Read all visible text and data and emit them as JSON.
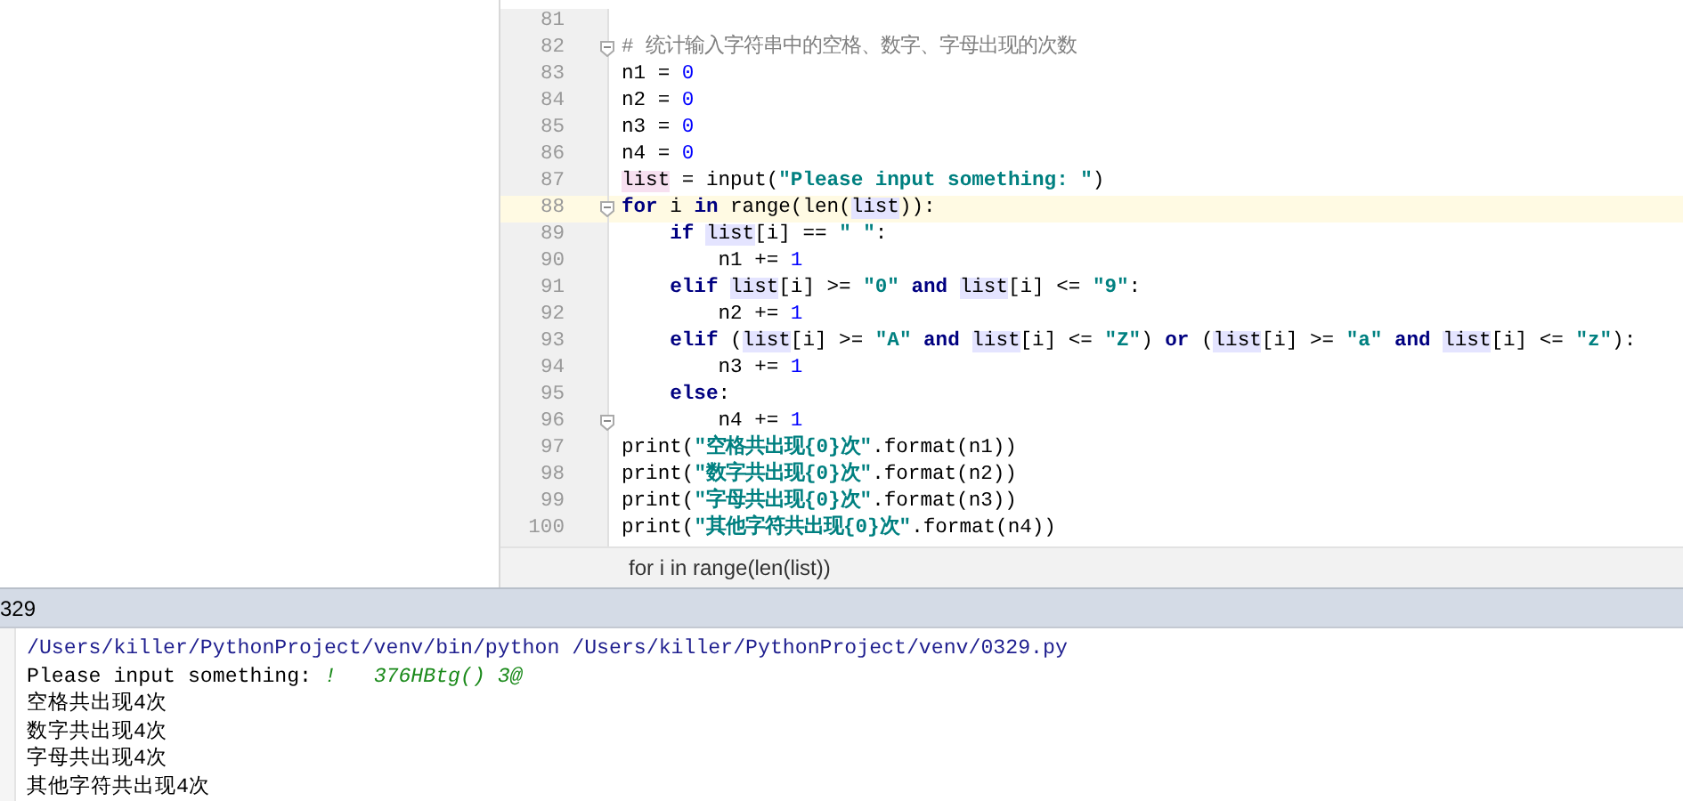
{
  "editor": {
    "lines": [
      {
        "number": "81",
        "current": false,
        "fold": false
      },
      {
        "number": "82",
        "current": false,
        "fold": true,
        "tokens": [
          {
            "kind": "comment",
            "t": "# 统计输入字符串中的空格、数字、字母出现的次数"
          }
        ]
      },
      {
        "number": "83",
        "current": false,
        "fold": false,
        "tokens": [
          {
            "kind": "plain",
            "t": "n1 = "
          },
          {
            "kind": "num",
            "t": "0"
          }
        ]
      },
      {
        "number": "84",
        "current": false,
        "fold": false,
        "tokens": [
          {
            "kind": "plain",
            "t": "n2 = "
          },
          {
            "kind": "num",
            "t": "0"
          }
        ]
      },
      {
        "number": "85",
        "current": false,
        "fold": false,
        "tokens": [
          {
            "kind": "plain",
            "t": "n3 = "
          },
          {
            "kind": "num",
            "t": "0"
          }
        ]
      },
      {
        "number": "86",
        "current": false,
        "fold": false,
        "tokens": [
          {
            "kind": "plain",
            "t": "n4 = "
          },
          {
            "kind": "num",
            "t": "0"
          }
        ]
      },
      {
        "number": "87",
        "current": false,
        "fold": false,
        "tokens": [
          {
            "kind": "vardef",
            "t": "list"
          },
          {
            "kind": "plain",
            "t": " = input("
          },
          {
            "kind": "str",
            "t": "\"Please input something: \""
          },
          {
            "kind": "plain",
            "t": ")"
          }
        ]
      },
      {
        "number": "88",
        "current": true,
        "fold": true,
        "tokens": [
          {
            "kind": "kw",
            "t": "for"
          },
          {
            "kind": "plain",
            "t": " i "
          },
          {
            "kind": "kw",
            "t": "in"
          },
          {
            "kind": "plain",
            "t": " range(len("
          },
          {
            "kind": "var",
            "t": "list"
          },
          {
            "kind": "plain",
            "t": ")):"
          }
        ]
      },
      {
        "number": "89",
        "current": false,
        "fold": false,
        "tokens": [
          {
            "kind": "kw",
            "t": "    if "
          },
          {
            "kind": "var",
            "t": "list"
          },
          {
            "kind": "plain",
            "t": "[i] == "
          },
          {
            "kind": "str",
            "t": "\" \""
          },
          {
            "kind": "plain",
            "t": ":"
          }
        ]
      },
      {
        "number": "90",
        "current": false,
        "fold": false,
        "tokens": [
          {
            "kind": "plain",
            "t": "        n1 += "
          },
          {
            "kind": "num",
            "t": "1"
          }
        ]
      },
      {
        "number": "91",
        "current": false,
        "fold": false,
        "tokens": [
          {
            "kind": "kw",
            "t": "    elif "
          },
          {
            "kind": "var",
            "t": "list"
          },
          {
            "kind": "plain",
            "t": "[i] >= "
          },
          {
            "kind": "str",
            "t": "\"0\""
          },
          {
            "kind": "kw",
            "t": " and "
          },
          {
            "kind": "var",
            "t": "list"
          },
          {
            "kind": "plain",
            "t": "[i] <= "
          },
          {
            "kind": "str",
            "t": "\"9\""
          },
          {
            "kind": "plain",
            "t": ":"
          }
        ]
      },
      {
        "number": "92",
        "current": false,
        "fold": false,
        "tokens": [
          {
            "kind": "plain",
            "t": "        n2 += "
          },
          {
            "kind": "num",
            "t": "1"
          }
        ]
      },
      {
        "number": "93",
        "current": false,
        "fold": false,
        "tokens": [
          {
            "kind": "kw",
            "t": "    elif"
          },
          {
            "kind": "plain",
            "t": " ("
          },
          {
            "kind": "var",
            "t": "list"
          },
          {
            "kind": "plain",
            "t": "[i] >= "
          },
          {
            "kind": "str",
            "t": "\"A\""
          },
          {
            "kind": "kw",
            "t": " and "
          },
          {
            "kind": "var",
            "t": "list"
          },
          {
            "kind": "plain",
            "t": "[i] <= "
          },
          {
            "kind": "str",
            "t": "\"Z\""
          },
          {
            "kind": "plain",
            "t": ") "
          },
          {
            "kind": "kw",
            "t": "or"
          },
          {
            "kind": "plain",
            "t": " ("
          },
          {
            "kind": "var",
            "t": "list"
          },
          {
            "kind": "plain",
            "t": "[i] >= "
          },
          {
            "kind": "str",
            "t": "\"a\""
          },
          {
            "kind": "kw",
            "t": " and "
          },
          {
            "kind": "var",
            "t": "list"
          },
          {
            "kind": "plain",
            "t": "[i] <= "
          },
          {
            "kind": "str",
            "t": "\"z\""
          },
          {
            "kind": "plain",
            "t": "):"
          }
        ]
      },
      {
        "number": "94",
        "current": false,
        "fold": false,
        "tokens": [
          {
            "kind": "plain",
            "t": "        n3 += "
          },
          {
            "kind": "num",
            "t": "1"
          }
        ]
      },
      {
        "number": "95",
        "current": false,
        "fold": false,
        "tokens": [
          {
            "kind": "kw",
            "t": "    else"
          },
          {
            "kind": "plain",
            "t": ":"
          }
        ]
      },
      {
        "number": "96",
        "current": false,
        "fold": true,
        "tokens": [
          {
            "kind": "plain",
            "t": "        n4 += "
          },
          {
            "kind": "num",
            "t": "1"
          }
        ]
      },
      {
        "number": "97",
        "current": false,
        "fold": false,
        "tokens": [
          {
            "kind": "plain",
            "t": "print("
          },
          {
            "kind": "str",
            "t": "\"空格共出现{0}次\""
          },
          {
            "kind": "plain",
            "t": ".format(n1))"
          }
        ]
      },
      {
        "number": "98",
        "current": false,
        "fold": false,
        "tokens": [
          {
            "kind": "plain",
            "t": "print("
          },
          {
            "kind": "str",
            "t": "\"数字共出现{0}次\""
          },
          {
            "kind": "plain",
            "t": ".format(n2))"
          }
        ]
      },
      {
        "number": "99",
        "current": false,
        "fold": false,
        "tokens": [
          {
            "kind": "plain",
            "t": "print("
          },
          {
            "kind": "str",
            "t": "\"字母共出现{0}次\""
          },
          {
            "kind": "plain",
            "t": ".format(n3))"
          }
        ]
      },
      {
        "number": "100",
        "current": false,
        "fold": false,
        "tokens": [
          {
            "kind": "plain",
            "t": "print("
          },
          {
            "kind": "str",
            "t": "\"其他字符共出现{0}次\""
          },
          {
            "kind": "plain",
            "t": ".format(n4))"
          }
        ]
      }
    ],
    "breadcrumb": "for i in range(len(list))"
  },
  "console": {
    "title": "329",
    "lines": [
      [
        {
          "kind": "path",
          "t": "/Users/killer/PythonProject/venv/bin/python /Users/killer/PythonProject/venv/0329.py"
        }
      ],
      [
        {
          "kind": "out",
          "t": "Please input something: "
        },
        {
          "kind": "input",
          "t": "!   376HBtg() 3@"
        }
      ],
      [
        {
          "kind": "out",
          "t": "空格共出现4次"
        }
      ],
      [
        {
          "kind": "out",
          "t": "数字共出现4次"
        }
      ],
      [
        {
          "kind": "out",
          "t": "字母共出现4次"
        }
      ],
      [
        {
          "kind": "out",
          "t": "其他字符共出现4次"
        }
      ]
    ]
  }
}
